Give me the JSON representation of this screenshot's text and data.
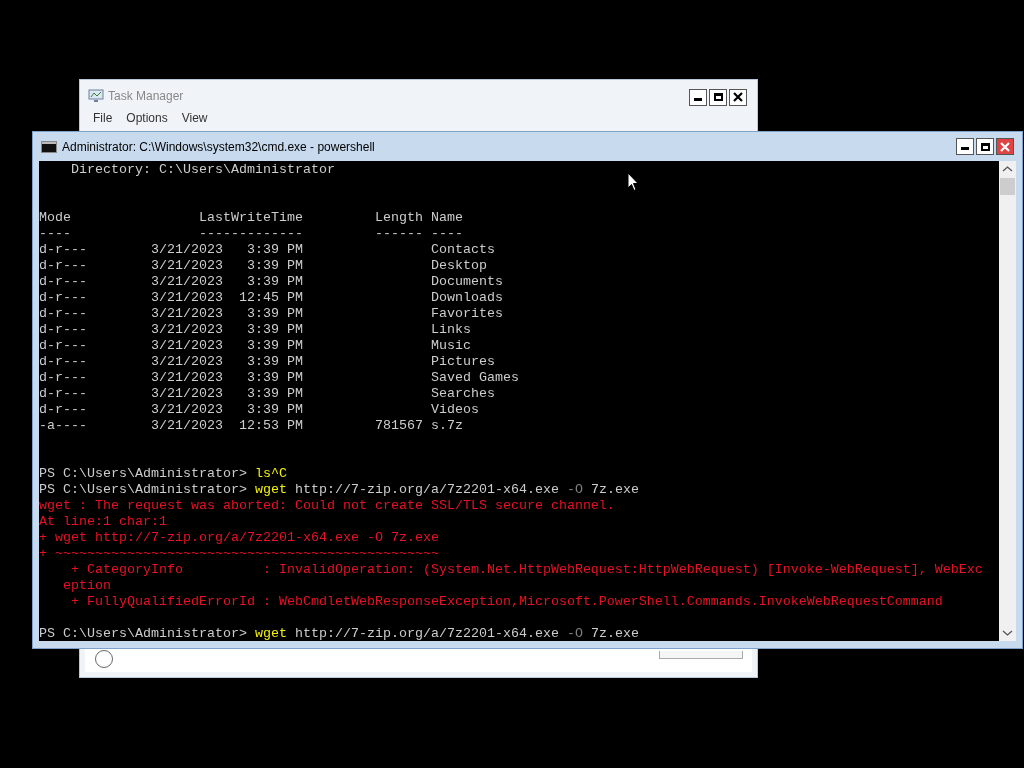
{
  "task_manager": {
    "title": "Task Manager",
    "menu": [
      "File",
      "Options",
      "View"
    ],
    "radio": {
      "selected": false
    }
  },
  "console": {
    "title": "Administrator: C:\\Windows\\system32\\cmd.exe - powershell",
    "lines": [
      {
        "kind": "text",
        "segments": [
          {
            "text": "    Directory: C:\\Users\\Administrator",
            "kind": "output"
          }
        ]
      },
      {
        "kind": "blank"
      },
      {
        "kind": "blank"
      },
      {
        "kind": "text",
        "segments": [
          {
            "text": "Mode                LastWriteTime         Length Name",
            "kind": "output"
          }
        ]
      },
      {
        "kind": "text",
        "segments": [
          {
            "text": "----                -------------         ------ ----",
            "kind": "output"
          }
        ]
      },
      {
        "kind": "text",
        "segments": [
          {
            "text": "d-r---        3/21/2023   3:39 PM                Contacts",
            "kind": "output"
          }
        ]
      },
      {
        "kind": "text",
        "segments": [
          {
            "text": "d-r---        3/21/2023   3:39 PM                Desktop",
            "kind": "output"
          }
        ]
      },
      {
        "kind": "text",
        "segments": [
          {
            "text": "d-r---        3/21/2023   3:39 PM                Documents",
            "kind": "output"
          }
        ]
      },
      {
        "kind": "text",
        "segments": [
          {
            "text": "d-r---        3/21/2023  12:45 PM                Downloads",
            "kind": "output"
          }
        ]
      },
      {
        "kind": "text",
        "segments": [
          {
            "text": "d-r---        3/21/2023   3:39 PM                Favorites",
            "kind": "output"
          }
        ]
      },
      {
        "kind": "text",
        "segments": [
          {
            "text": "d-r---        3/21/2023   3:39 PM                Links",
            "kind": "output"
          }
        ]
      },
      {
        "kind": "text",
        "segments": [
          {
            "text": "d-r---        3/21/2023   3:39 PM                Music",
            "kind": "output"
          }
        ]
      },
      {
        "kind": "text",
        "segments": [
          {
            "text": "d-r---        3/21/2023   3:39 PM                Pictures",
            "kind": "output"
          }
        ]
      },
      {
        "kind": "text",
        "segments": [
          {
            "text": "d-r---        3/21/2023   3:39 PM                Saved Games",
            "kind": "output"
          }
        ]
      },
      {
        "kind": "text",
        "segments": [
          {
            "text": "d-r---        3/21/2023   3:39 PM                Searches",
            "kind": "output"
          }
        ]
      },
      {
        "kind": "text",
        "segments": [
          {
            "text": "d-r---        3/21/2023   3:39 PM                Videos",
            "kind": "output"
          }
        ]
      },
      {
        "kind": "text",
        "segments": [
          {
            "text": "-a----        3/21/2023  12:53 PM         781567 s.7z",
            "kind": "output"
          }
        ]
      },
      {
        "kind": "blank"
      },
      {
        "kind": "blank"
      },
      {
        "kind": "text",
        "segments": [
          {
            "text": "PS C:\\Users\\Administrator> ",
            "kind": "output"
          },
          {
            "text": "ls^C",
            "kind": "command"
          }
        ]
      },
      {
        "kind": "text",
        "segments": [
          {
            "text": "PS C:\\Users\\Administrator> ",
            "kind": "output"
          },
          {
            "text": "wget",
            "kind": "command"
          },
          {
            "text": " http://7-zip.org/a/7z2201-x64.exe ",
            "kind": "output"
          },
          {
            "text": "-O",
            "kind": "parameter"
          },
          {
            "text": " 7z.exe",
            "kind": "output"
          }
        ]
      },
      {
        "kind": "text",
        "segments": [
          {
            "text": "wget : The request was aborted: Could not create SSL/TLS secure channel.",
            "kind": "error"
          }
        ]
      },
      {
        "kind": "text",
        "segments": [
          {
            "text": "At line:1 char:1",
            "kind": "error"
          }
        ]
      },
      {
        "kind": "text",
        "segments": [
          {
            "text": "+ wget http://7-zip.org/a/7z2201-x64.exe -O 7z.exe",
            "kind": "error"
          }
        ]
      },
      {
        "kind": "text",
        "segments": [
          {
            "text": "+ ~~~~~~~~~~~~~~~~~~~~~~~~~~~~~~~~~~~~~~~~~~~~~~~~",
            "kind": "error"
          }
        ]
      },
      {
        "kind": "text",
        "segments": [
          {
            "text": "    + CategoryInfo          : InvalidOperation: (System.Net.HttpWebRequest:HttpWebRequest) [Invoke-WebRequest], WebExc",
            "kind": "error"
          }
        ]
      },
      {
        "kind": "text",
        "segments": [
          {
            "text": "   eption",
            "kind": "error"
          }
        ]
      },
      {
        "kind": "text",
        "segments": [
          {
            "text": "    + FullyQualifiedErrorId : WebCmdletWebResponseException,Microsoft.PowerShell.Commands.InvokeWebRequestCommand",
            "kind": "error"
          }
        ]
      },
      {
        "kind": "blank"
      },
      {
        "kind": "text",
        "segments": [
          {
            "text": "PS C:\\Users\\Administrator> ",
            "kind": "output"
          },
          {
            "text": "wget",
            "kind": "command"
          },
          {
            "text": " http://7-zip.org/a/7z2201-x64.exe ",
            "kind": "output"
          },
          {
            "text": "-O",
            "kind": "parameter"
          },
          {
            "text": " 7z.exe",
            "kind": "output"
          }
        ]
      }
    ]
  }
}
